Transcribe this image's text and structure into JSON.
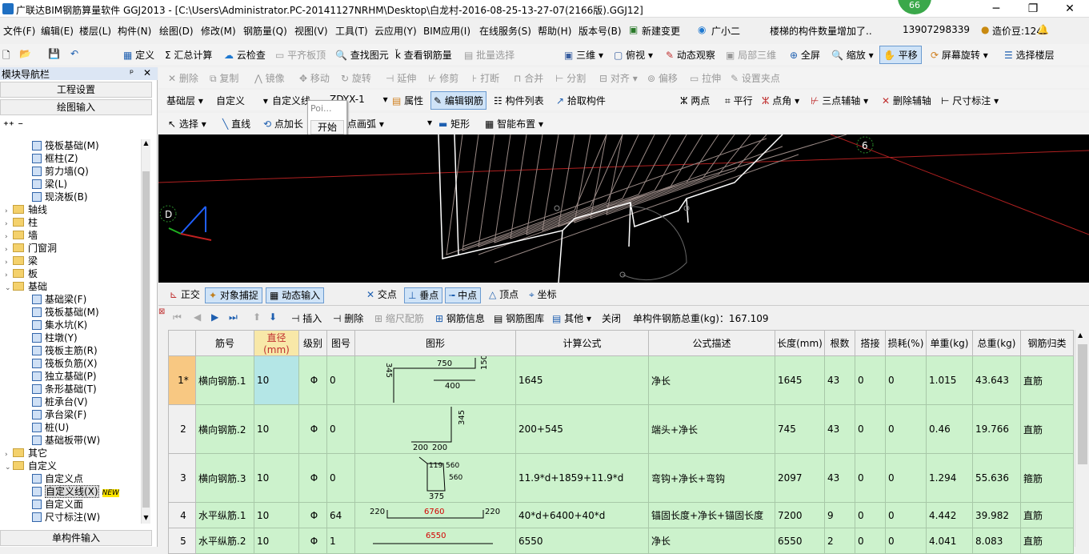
{
  "titlebar": {
    "title": "广联达BIM钢筋算量软件 GGJ2013 - [C:\\Users\\Administrator.PC-20141127NRHM\\Desktop\\白龙村-2016-08-25-13-27-07(2166版).GGJ12]",
    "badge": "66",
    "minimize": "─",
    "maximize": "❐",
    "close": "✕"
  },
  "menu": [
    "文件(F)",
    "编辑(E)",
    "楼层(L)",
    "构件(N)",
    "绘图(D)",
    "修改(M)",
    "钢筋量(Q)",
    "视图(V)",
    "工具(T)",
    "云应用(Y)",
    "BIM应用(I)",
    "在线服务(S)",
    "帮助(H)",
    "版本号(B)",
    "新建变更",
    "广小二"
  ],
  "menu_notice": "楼梯的构件数量增加了..",
  "menu_phone": "13907298339",
  "menu_coins": "造价豆:124",
  "toolbar1": [
    "定义",
    "Σ 汇总计算",
    "云检查",
    "平齐板顶",
    "查找图元",
    "查看钢筋量",
    "批量选择",
    "三维",
    "俯视",
    "动态观察",
    "局部三维",
    "全屏",
    "缩放",
    "平移",
    "屏幕旋转",
    "选择楼层"
  ],
  "toolbar2": [
    "删除",
    "复制",
    "镜像",
    "移动",
    "旋转",
    "延伸",
    "修剪",
    "打断",
    "合并",
    "分割",
    "对齐",
    "偏移",
    "拉伸",
    "设置夹点"
  ],
  "toolbar3": {
    "floor": "基础层",
    "cat1": "自定义",
    "cat2": "自定义线",
    "comp": "ZDYX-1",
    "attr": "属性",
    "edit": "编辑钢筋",
    "list": "构件列表",
    "pick": "拾取构件",
    "two_pt": "两点",
    "parallel": "平行",
    "pt_angle": "点角",
    "three_pt": "三点辅轴",
    "del_aux": "删除辅轴",
    "dim": "尺寸标注"
  },
  "toolbar4": {
    "select": "选择",
    "line": "直线",
    "pt_len": "点加长",
    "arc": "点画弧",
    "rect": "矩形",
    "smart": "智能布置"
  },
  "popup": {
    "title": "Poi...",
    "start": "开始"
  },
  "panel": {
    "title": "模块导航栏",
    "pin": "ᵖ",
    "close": "✕",
    "btn1": "工程设置",
    "btn2": "绘图输入",
    "bottom": "单构件输入"
  },
  "tree": [
    {
      "label": "筏板基础(M)",
      "lvl": 2
    },
    {
      "label": "框柱(Z)",
      "lvl": 2
    },
    {
      "label": "剪力墙(Q)",
      "lvl": 2
    },
    {
      "label": "梁(L)",
      "lvl": 2
    },
    {
      "label": "现浇板(B)",
      "lvl": 2
    },
    {
      "label": "轴线",
      "lvl": 0
    },
    {
      "label": "柱",
      "lvl": 0
    },
    {
      "label": "墙",
      "lvl": 0
    },
    {
      "label": "门窗洞",
      "lvl": 0
    },
    {
      "label": "梁",
      "lvl": 0
    },
    {
      "label": "板",
      "lvl": 0
    },
    {
      "label": "基础",
      "lvl": 0,
      "open": true
    },
    {
      "label": "基础梁(F)",
      "lvl": 2
    },
    {
      "label": "筏板基础(M)",
      "lvl": 2
    },
    {
      "label": "集水坑(K)",
      "lvl": 2
    },
    {
      "label": "柱墩(Y)",
      "lvl": 2
    },
    {
      "label": "筏板主筋(R)",
      "lvl": 2
    },
    {
      "label": "筏板负筋(X)",
      "lvl": 2
    },
    {
      "label": "独立基础(P)",
      "lvl": 2
    },
    {
      "label": "条形基础(T)",
      "lvl": 2
    },
    {
      "label": "桩承台(V)",
      "lvl": 2
    },
    {
      "label": "承台梁(F)",
      "lvl": 2
    },
    {
      "label": "桩(U)",
      "lvl": 2
    },
    {
      "label": "基础板带(W)",
      "lvl": 2
    },
    {
      "label": "其它",
      "lvl": 0
    },
    {
      "label": "自定义",
      "lvl": 0,
      "open": true
    },
    {
      "label": "自定义点",
      "lvl": 2
    },
    {
      "label": "自定义线(X)",
      "lvl": 2,
      "sel": true,
      "new": "NEW"
    },
    {
      "label": "自定义面",
      "lvl": 2
    },
    {
      "label": "尺寸标注(W)",
      "lvl": 2
    }
  ],
  "canvas": {
    "axis_d": "D",
    "axis_6": "6"
  },
  "snap": [
    "正交",
    "对象捕捉",
    "动态输入",
    "交点",
    "垂点",
    "中点",
    "顶点",
    "坐标"
  ],
  "gridtb": {
    "insert": "插入",
    "delete": "删除",
    "scale": "缩尺配筋",
    "info": "钢筋信息",
    "lib": "钢筋图库",
    "other": "其他",
    "close": "关闭",
    "total": "单构件钢筋总重(kg)：167.109"
  },
  "grid": {
    "headers": [
      "筋号",
      "直径(mm)",
      "级别",
      "图号",
      "图形",
      "计算公式",
      "公式描述",
      "长度(mm)",
      "根数",
      "搭接",
      "损耗(%)",
      "单重(kg)",
      "总重(kg)",
      "钢筋归类"
    ],
    "rows": [
      {
        "rh": "1*",
        "name": "横向钢筋.1",
        "dia": "10",
        "grade": "Φ",
        "fig": "0",
        "f1": "345",
        "f2": "750",
        "f3": "150",
        "f4": "400",
        "formula": "1645",
        "desc": "净长",
        "len": "1645",
        "num": "43",
        "lap": "0",
        "loss": "0",
        "unit": "1.015",
        "total": "43.643",
        "cat": "直筋"
      },
      {
        "rh": "2",
        "name": "横向钢筋.2",
        "dia": "10",
        "grade": "Φ",
        "fig": "0",
        "f1": "345",
        "f2": "200",
        "f3": "200",
        "formula": "200+545",
        "desc": "端头+净长",
        "len": "745",
        "num": "43",
        "lap": "0",
        "loss": "0",
        "unit": "0.46",
        "total": "19.766",
        "cat": "直筋"
      },
      {
        "rh": "3",
        "name": "横向钢筋.3",
        "dia": "10",
        "grade": "Φ",
        "fig": "0",
        "f1": "119",
        "f2": "560",
        "f3": "560",
        "f4": "375",
        "formula": "11.9*d+1859+11.9*d",
        "desc": "弯钩+净长+弯钩",
        "len": "2097",
        "num": "43",
        "lap": "0",
        "loss": "0",
        "unit": "1.294",
        "total": "55.636",
        "cat": "箍筋"
      },
      {
        "rh": "4",
        "name": "水平纵筋.1",
        "dia": "10",
        "grade": "Φ",
        "fig": "64",
        "f1": "220",
        "f2": "6760",
        "f3": "220",
        "formula": "40*d+6400+40*d",
        "desc": "锚固长度+净长+锚固长度",
        "len": "7200",
        "num": "9",
        "lap": "0",
        "loss": "0",
        "unit": "4.442",
        "total": "39.982",
        "cat": "直筋"
      },
      {
        "rh": "5",
        "name": "水平纵筋.2",
        "dia": "10",
        "grade": "Φ",
        "fig": "1",
        "f2": "6550",
        "formula": "6550",
        "desc": "净长",
        "len": "6550",
        "num": "2",
        "lap": "0",
        "loss": "0",
        "unit": "4.041",
        "total": "8.083",
        "cat": "直筋"
      }
    ]
  }
}
